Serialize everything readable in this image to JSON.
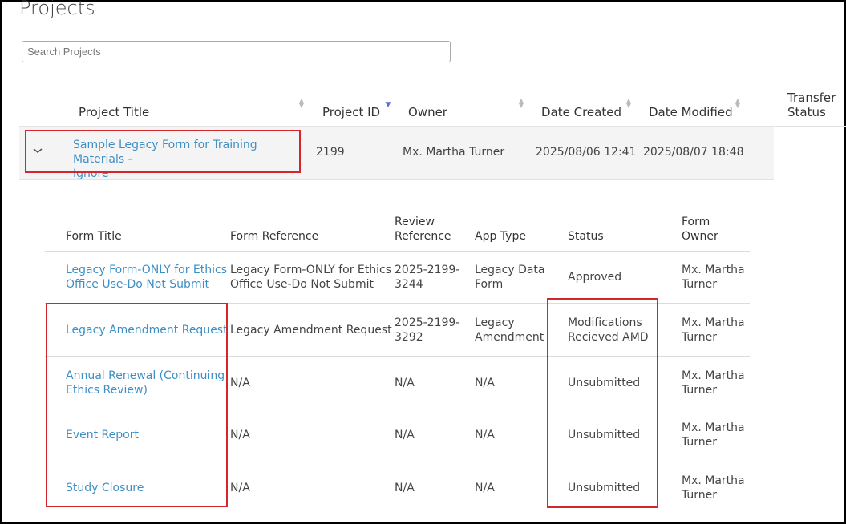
{
  "page": {
    "title": "Projects"
  },
  "search": {
    "placeholder": "Search Projects"
  },
  "projects_table": {
    "headers": {
      "title": "Project Title",
      "id": "Project ID",
      "owner": "Owner",
      "created": "Date Created",
      "modified": "Date Modified",
      "transfer_1": "Transfer",
      "transfer_2": "Status"
    },
    "sorted_column": "Project ID",
    "rows": [
      {
        "title_1": "Sample Legacy Form for Training Materials -",
        "title_2": "Ignore",
        "id": "2199",
        "owner": "Mx. Martha Turner",
        "created": "2025/08/06 12:41",
        "modified": "2025/08/07 18:48",
        "transfer_status": ""
      }
    ]
  },
  "forms_table": {
    "headers": {
      "form_title": "Form Title",
      "form_reference": "Form Reference",
      "review_reference_1": "Review",
      "review_reference_2": "Reference",
      "app_type": "App Type",
      "status": "Status",
      "form_owner_1": "Form",
      "form_owner_2": "Owner"
    },
    "rows": [
      {
        "title_1": "Legacy Form-ONLY for Ethics",
        "title_2": "Office Use-Do Not Submit",
        "ref_1": "Legacy Form-ONLY for Ethics",
        "ref_2": "Office Use-Do Not Submit",
        "review_1": "2025-2199-",
        "review_2": "3244",
        "app_1": "Legacy Data",
        "app_2": "Form",
        "status_1": "Approved",
        "status_2": "",
        "owner_1": "Mx. Martha",
        "owner_2": "Turner"
      },
      {
        "title_1": "Legacy Amendment Request",
        "title_2": "",
        "ref_1": "Legacy Amendment Request",
        "ref_2": "",
        "review_1": "2025-2199-",
        "review_2": "3292",
        "app_1": "Legacy",
        "app_2": "Amendment",
        "status_1": "Modifications",
        "status_2": "Recieved AMD",
        "owner_1": "Mx. Martha",
        "owner_2": "Turner"
      },
      {
        "title_1": "Annual Renewal (Continuing",
        "title_2": "Ethics Review)",
        "ref_1": "N/A",
        "ref_2": "",
        "review_1": "N/A",
        "review_2": "",
        "app_1": "N/A",
        "app_2": "",
        "status_1": "Unsubmitted",
        "status_2": "",
        "owner_1": "Mx. Martha",
        "owner_2": "Turner"
      },
      {
        "title_1": "Event Report",
        "title_2": "",
        "ref_1": "N/A",
        "ref_2": "",
        "review_1": "N/A",
        "review_2": "",
        "app_1": "N/A",
        "app_2": "",
        "status_1": "Unsubmitted",
        "status_2": "",
        "owner_1": "Mx. Martha",
        "owner_2": "Turner"
      },
      {
        "title_1": "Study Closure",
        "title_2": "",
        "ref_1": "N/A",
        "ref_2": "",
        "review_1": "N/A",
        "review_2": "",
        "app_1": "N/A",
        "app_2": "",
        "status_1": "Unsubmitted",
        "status_2": "",
        "owner_1": "Mx. Martha",
        "owner_2": "Turner"
      }
    ]
  },
  "colors": {
    "link": "#3d8fc4",
    "highlight": "#d1272d",
    "row_bg": "#f4f4f4",
    "sort_active": "#5a6fd6"
  }
}
